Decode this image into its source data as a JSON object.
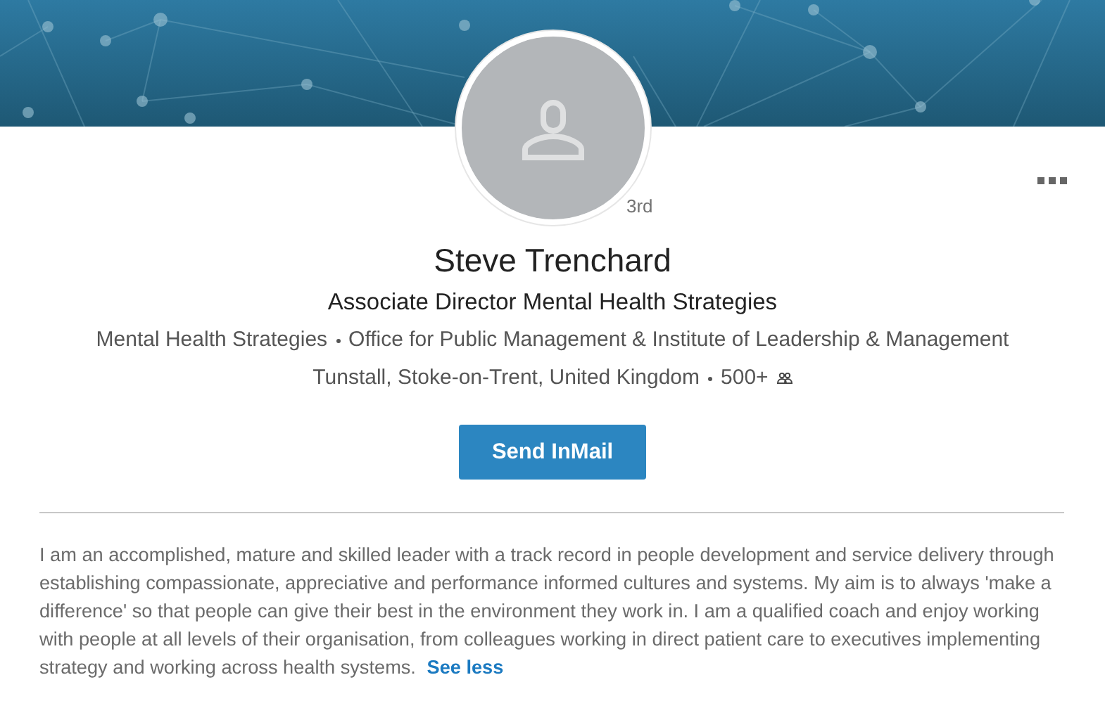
{
  "profile": {
    "degree": "3rd",
    "name": "Steve Trenchard",
    "headline": "Associate Director Mental Health Strategies",
    "organizations": [
      "Mental Health Strategies",
      "Office for Public Management & Institute of Leadership & Management"
    ],
    "location": "Tunstall, Stoke-on-Trent, United Kingdom",
    "connections": "500+"
  },
  "actions": {
    "primary_button": "Send InMail"
  },
  "summary": {
    "text": "I am an accomplished, mature and skilled leader with a track record in people development and service delivery through establishing compassionate, appreciative and performance informed cultures and systems. My aim is to always 'make a difference' so that people can give their best in the environment they work in. I am a qualified coach and enjoy working with people at all levels of their organisation, from colleagues working in direct patient care to executives implementing strategy and working across health systems.",
    "link": "See less"
  }
}
